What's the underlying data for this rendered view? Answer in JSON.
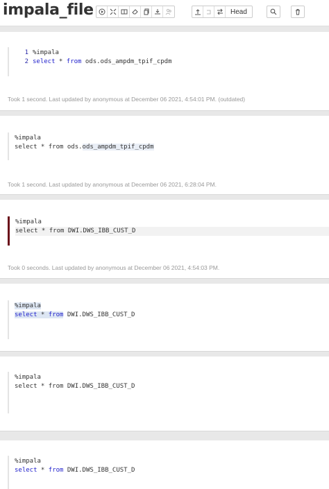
{
  "header": {
    "title": "impala_file",
    "head_label": "Head"
  },
  "icons": {
    "run_all": "play-circle-icon",
    "hide_code": "collapse-arrows-icon",
    "hide_output": "book-icon",
    "clear_output": "eraser-icon",
    "clone": "copy-icon",
    "export": "download-icon",
    "settings": "people-icon",
    "commit": "upload-icon",
    "revert": "revert-icon",
    "compare": "compare-arrows-icon",
    "search": "search-icon",
    "delete": "trash-icon"
  },
  "colors": {
    "focus_bar": "#6b0f1a",
    "keyword": "#2222cc",
    "status_text": "#999999"
  },
  "paragraphs": [
    {
      "line_numbers": [
        "1",
        "2"
      ],
      "code_line1": "%impala",
      "kw_select": "select",
      "star": " * ",
      "kw_from": "from",
      "table": " ods.ods_ampdm_tpif_cpdm",
      "status": "Took 1 second. Last updated by anonymous at December 06 2021, 4:54:01 PM. (outdated)"
    },
    {
      "code_line1": "%impala",
      "code_prefix": "select * from ods.",
      "table": "ods_ampdm_tpif_cpdm",
      "status": "Took 1 second. Last updated by anonymous at December 06 2021, 6:28:04 PM."
    },
    {
      "code_line1": "%impala",
      "code_line2": "select * from DWI.DWS_IBB_CUST_D",
      "status": "Took 0 seconds. Last updated by anonymous at December 06 2021, 4:54:03 PM."
    },
    {
      "code_line1": "%impala",
      "kw_select": "select",
      "star": " * ",
      "kw_from": "from",
      "table": " DWI.DWS_IBB_CUST_D"
    },
    {
      "code_line1": "%impala",
      "code_line2": "select * from DWI.DWS_IBB_CUST_D"
    },
    {
      "code_line1": "%impala",
      "kw_select": "select",
      "star": " * ",
      "kw_from": "from",
      "table": " DWI.DWS_IBB_CUST_D"
    }
  ]
}
